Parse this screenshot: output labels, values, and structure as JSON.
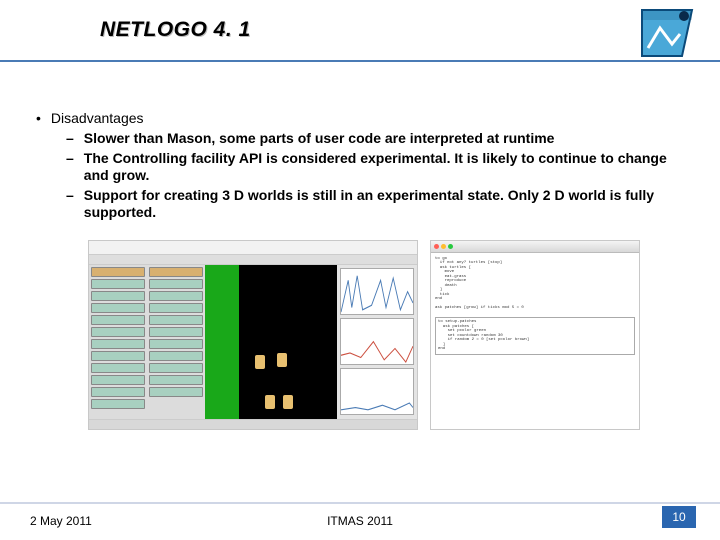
{
  "header": {
    "title": "NETLOGO 4. 1"
  },
  "content": {
    "heading": "Disadvantages",
    "items": [
      "Slower than Mason, some parts of user code are interpreted at runtime",
      "The Controlling facility API is considered experimental. It is likely to continue to change and grow.",
      "Support for creating 3 D worlds is still in an experimental state. Only 2 D world is fully supported."
    ]
  },
  "footer": {
    "date": "2 May 2011",
    "venue": "ITMAS 2011",
    "page": "10"
  }
}
